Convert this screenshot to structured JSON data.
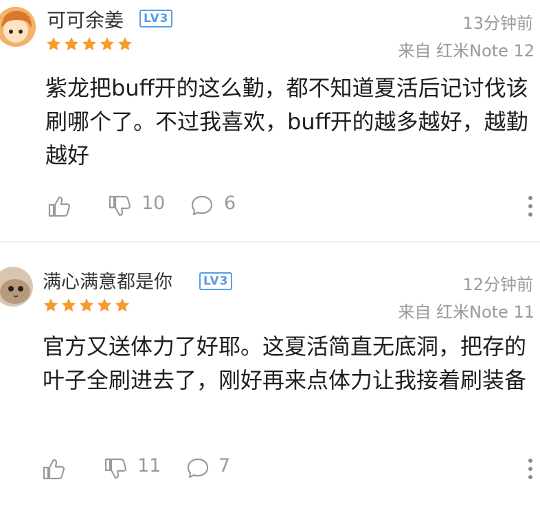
{
  "comments": [
    {
      "username": "可可余姜",
      "level": "LV3",
      "rating": 5,
      "time": "13分钟前",
      "device": "来自 红米Note 12",
      "content": "紫龙把buff开的这么勤，都不知道夏活后记讨伐该刷哪个了。不过我喜欢，buff开的越多越好，越勤越好",
      "dislikes": "10",
      "replies": "6"
    },
    {
      "username": "满心满意都是你",
      "level": "LV3",
      "rating": 5,
      "time": "12分钟前",
      "device": "来自 红米Note 11",
      "content": "官方又送体力了好耶。这夏活简直无底洞，把存的叶子全刷进去了，刚好再来点体力让我接着刷装备",
      "dislikes": "11",
      "replies": "7"
    }
  ],
  "colors": {
    "star": "#f79b2b",
    "level_badge": "#5a9de6",
    "meta_text": "#9a9a9a"
  },
  "icons": [
    "thumbs-up-icon",
    "thumbs-down-icon",
    "comment-bubble-icon",
    "more-vertical-icon",
    "star-icon"
  ]
}
